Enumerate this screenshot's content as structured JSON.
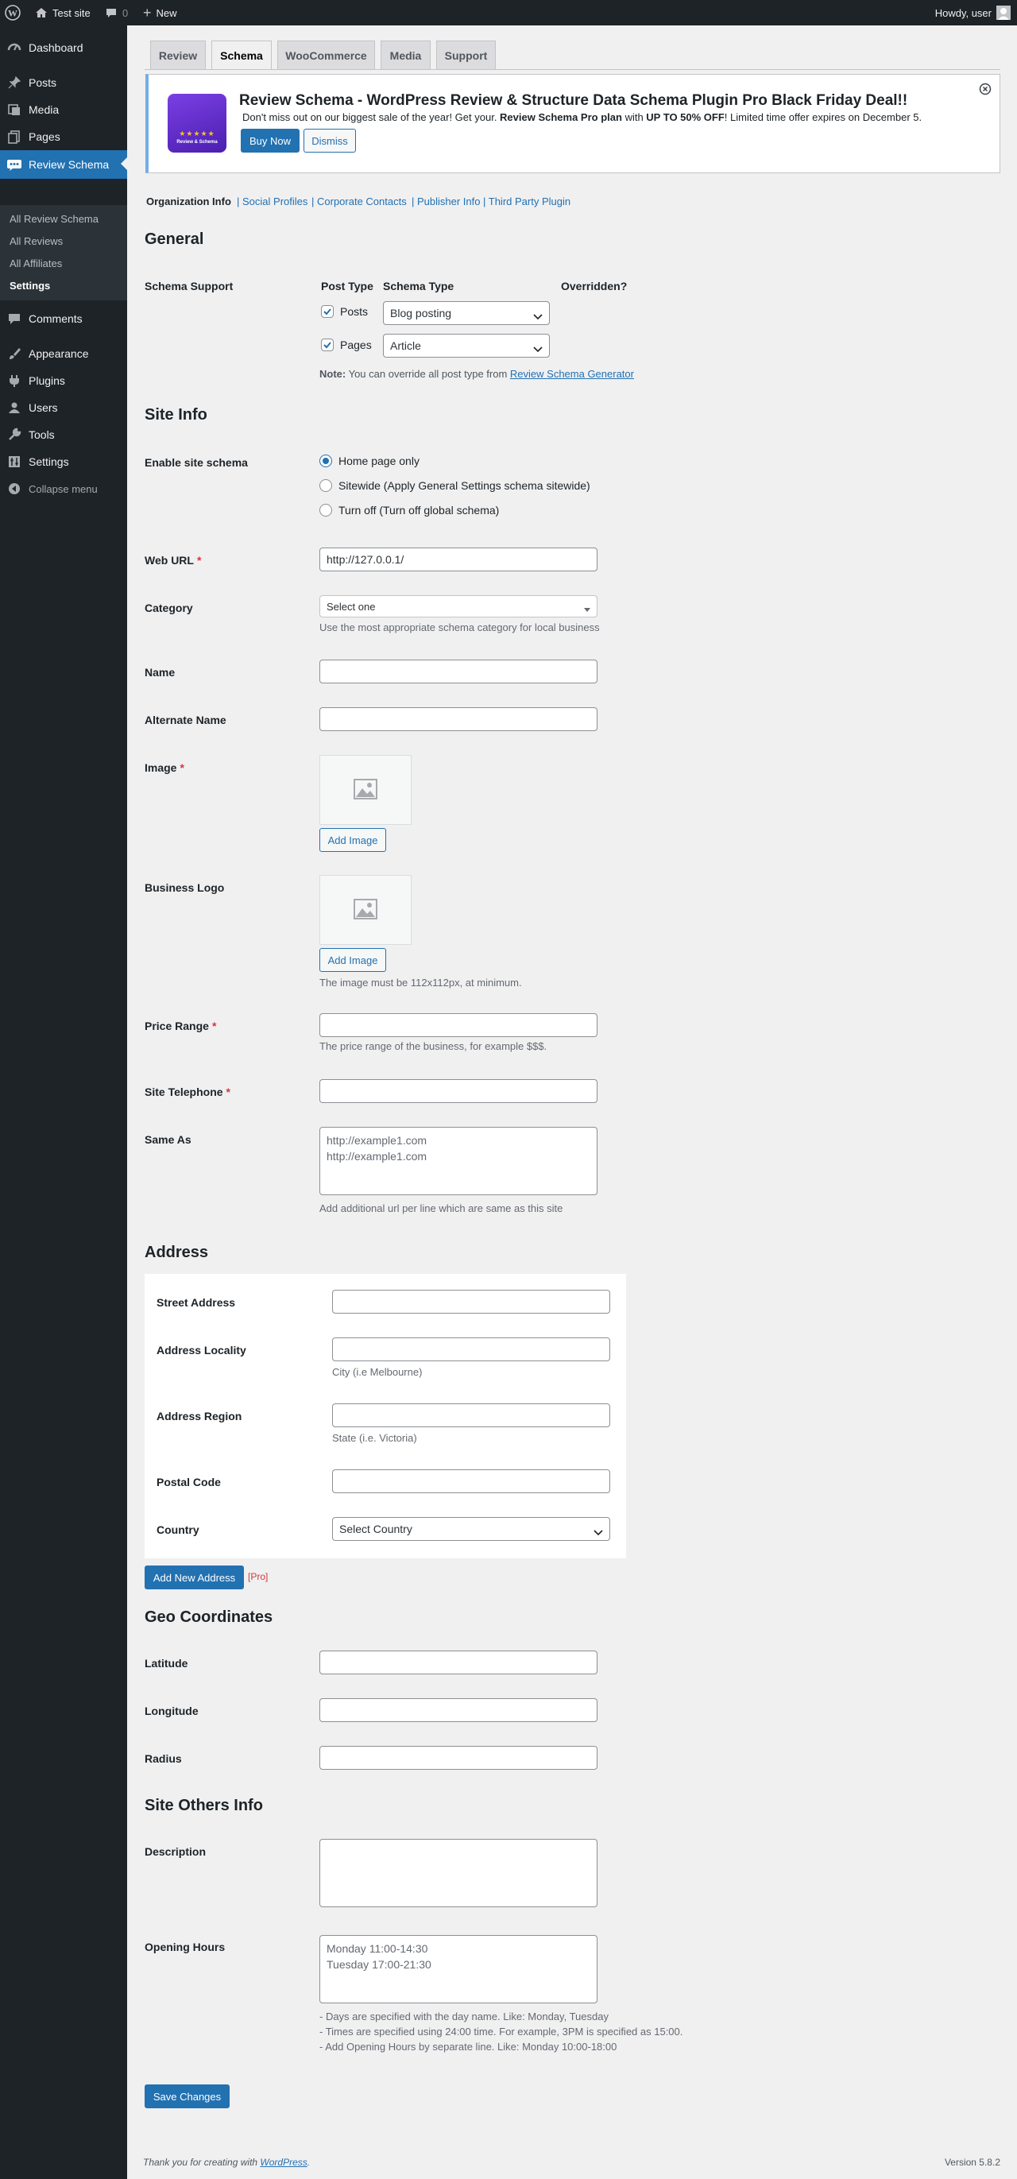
{
  "adminbar": {
    "site": "Test site",
    "comments": "0",
    "new": "New",
    "howdy": "Howdy, user"
  },
  "sidebar": {
    "items": [
      {
        "label": "Dashboard"
      },
      {
        "label": "Posts"
      },
      {
        "label": "Media"
      },
      {
        "label": "Pages"
      },
      {
        "label": "Review Schema"
      },
      {
        "label": "Comments"
      },
      {
        "label": "Appearance"
      },
      {
        "label": "Plugins"
      },
      {
        "label": "Users"
      },
      {
        "label": "Tools"
      },
      {
        "label": "Settings"
      },
      {
        "label": "Collapse menu"
      }
    ],
    "submenu": [
      "All Review Schema",
      "All Reviews",
      "All Affiliates",
      "Settings"
    ]
  },
  "tabs": [
    "Review",
    "Schema",
    "WooCommerce",
    "Media",
    "Support"
  ],
  "notice": {
    "title": "Review Schema - WordPress Review & Structure Data Schema Plugin Pro Black Friday Deal!!",
    "text_a": "Don't miss out on our biggest sale of the year! Get your. ",
    "text_b": "Review Schema Pro plan",
    "text_c": " with ",
    "text_d": "UP TO 50% OFF",
    "text_e": "! Limited time offer expires on December 5.",
    "buy": "Buy Now",
    "dismiss": "Dismiss",
    "logo_text": "Review & Schema"
  },
  "subnav": {
    "current": "Organization Info",
    "links": [
      "Social Profiles",
      "Corporate Contacts",
      "Publisher Info",
      "Third Party Plugin"
    ]
  },
  "general": {
    "heading": "General",
    "schema_support": "Schema Support",
    "col_post_type": "Post Type",
    "col_schema_type": "Schema Type",
    "col_overridden": "Overridden?",
    "rows": [
      {
        "type": "Posts",
        "schema": "Blog posting"
      },
      {
        "type": "Pages",
        "schema": "Article"
      }
    ],
    "note_label": "Note:",
    "note_text": " You can override all post type from ",
    "note_link": "Review Schema Generator"
  },
  "site_info": {
    "heading": "Site Info",
    "enable_label": "Enable site schema",
    "options": [
      "Home page only",
      "Sitewide (Apply General Settings schema sitewide)",
      "Turn off (Turn off global schema)"
    ],
    "web_url_label": "Web URL",
    "web_url_value": "http://127.0.0.1/",
    "category_label": "Category",
    "category_value": "Select one",
    "category_desc": "Use the most appropriate schema category for local business",
    "name_label": "Name",
    "alt_name_label": "Alternate Name",
    "image_label": "Image",
    "add_image": "Add Image",
    "logo_label": "Business Logo",
    "logo_desc": "The image must be 112x112px, at minimum.",
    "price_label": "Price Range",
    "price_desc": "The price range of the business, for example $$$.",
    "tel_label": "Site Telephone",
    "same_as_label": "Same As",
    "same_as_placeholder_1": "http://example1.com",
    "same_as_placeholder_2": "http://example1.com",
    "same_as_desc": "Add additional url per line which are same as this site"
  },
  "address": {
    "heading": "Address",
    "street": "Street Address",
    "locality": "Address Locality",
    "locality_desc": "City (i.e Melbourne)",
    "region": "Address Region",
    "region_desc": "State (i.e. Victoria)",
    "postal": "Postal Code",
    "country": "Country",
    "country_value": "Select Country",
    "add_new": "Add New Address",
    "pro": "[Pro]"
  },
  "geo": {
    "heading": "Geo Coordinates",
    "lat": "Latitude",
    "lng": "Longitude",
    "radius": "Radius"
  },
  "others": {
    "heading": "Site Others Info",
    "desc_label": "Description",
    "hours_label": "Opening Hours",
    "hours_1": "Monday 11:00-14:30",
    "hours_2": "Tuesday 17:00-21:30",
    "help_1": "- Days are specified with the day name. Like: Monday, Tuesday",
    "help_2": "- Times are specified using 24:00 time. For example, 3PM is specified as 15:00.",
    "help_3": "- Add Opening Hours by separate line. Like: Monday 10:00-18:00"
  },
  "save": "Save Changes",
  "footer": {
    "thanks": "Thank you for creating with ",
    "wp": "WordPress",
    "dot": ".",
    "version": "Version 5.8.2"
  }
}
